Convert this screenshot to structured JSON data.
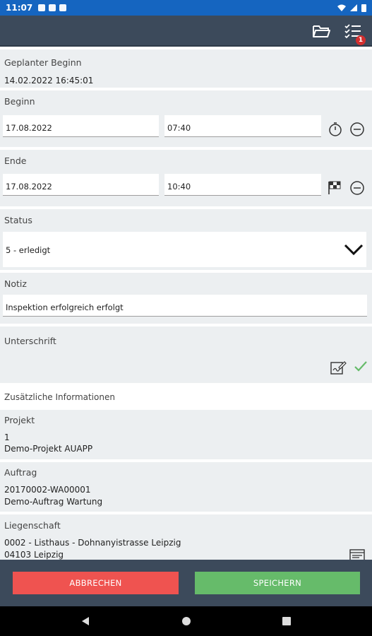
{
  "status_bar": {
    "time": "11:07"
  },
  "toolbar": {
    "badge_count": "1",
    "icons": [
      "folder-open-icon",
      "checklist-icon"
    ]
  },
  "geplanter_beginn": {
    "label": "Geplanter Beginn",
    "value": "14.02.2022 16:45:01"
  },
  "beginn": {
    "label": "Beginn",
    "date": "17.08.2022",
    "time": "07:40"
  },
  "ende": {
    "label": "Ende",
    "date": "17.08.2022",
    "time": "10:40"
  },
  "status": {
    "label": "Status",
    "selected": "5 - erledigt"
  },
  "notiz": {
    "label": "Notiz",
    "value": "Inspektion erfolgreich erfolgt"
  },
  "unterschrift": {
    "label": "Unterschrift"
  },
  "zusaetzliche_info": {
    "label": "Zusätzliche Informationen"
  },
  "projekt": {
    "label": "Projekt",
    "line1": "1",
    "line2": "Demo-Projekt AUAPP"
  },
  "auftrag": {
    "label": "Auftrag",
    "line1": "20170002-WA00001",
    "line2": "Demo-Auftrag Wartung"
  },
  "liegenschaft": {
    "label": "Liegenschaft",
    "line1": "0002 - Listhaus - Dohnanyistrasse Leipzig",
    "line2": "04103 Leipzig"
  },
  "buttons": {
    "cancel": "ABBRECHEN",
    "save": "SPEICHERN"
  },
  "colors": {
    "statusbar": "#1565c0",
    "toolbar": "#3c4a5b",
    "cancel": "#ef5350",
    "save": "#66bb6a",
    "section": "#eceff1"
  }
}
